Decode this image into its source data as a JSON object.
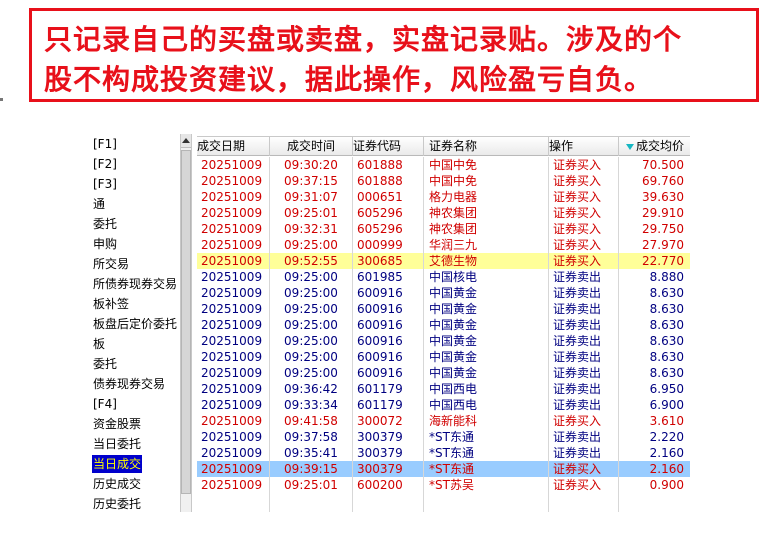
{
  "banner": {
    "line1": "只记录自己的买盘或卖盘，实盘记录贴。涉及的个",
    "line2": "股不构成投资建议，据此操作，风险盈亏自负。"
  },
  "sidebar": {
    "items": [
      "[F1]",
      "[F2]",
      "[F3]",
      "通",
      "委托",
      "申购",
      "所交易",
      "所债券现券交易",
      "板补签",
      "板盘后定价委托",
      "板",
      "委托",
      "债券现券交易",
      "[F4]",
      "资金股票",
      "当日委托",
      "当日成交",
      "历史成交",
      "历史委托"
    ],
    "active_index": 16
  },
  "table": {
    "headers": [
      "成交日期",
      "成交时间",
      "证券代码",
      "证券名称",
      "操作",
      "成交均价"
    ],
    "sort_column": "成交均价",
    "rows": [
      {
        "date": "20251009",
        "time": "09:30:20",
        "code": "601888",
        "name": "中国中免",
        "op": "证券买入",
        "price": "70.500",
        "kind": "buy"
      },
      {
        "date": "20251009",
        "time": "09:37:15",
        "code": "601888",
        "name": "中国中免",
        "op": "证券买入",
        "price": "69.760",
        "kind": "buy"
      },
      {
        "date": "20251009",
        "time": "09:31:07",
        "code": "000651",
        "name": "格力电器",
        "op": "证券买入",
        "price": "39.630",
        "kind": "buy"
      },
      {
        "date": "20251009",
        "time": "09:25:01",
        "code": "605296",
        "name": "神农集团",
        "op": "证券买入",
        "price": "29.910",
        "kind": "buy"
      },
      {
        "date": "20251009",
        "time": "09:32:31",
        "code": "605296",
        "name": "神农集团",
        "op": "证券买入",
        "price": "29.750",
        "kind": "buy"
      },
      {
        "date": "20251009",
        "time": "09:25:00",
        "code": "000999",
        "name": "华润三九",
        "op": "证券买入",
        "price": "27.970",
        "kind": "buy"
      },
      {
        "date": "20251009",
        "time": "09:52:55",
        "code": "300685",
        "name": "艾德生物",
        "op": "证券买入",
        "price": "22.770",
        "kind": "buy",
        "highlight": "yellow"
      },
      {
        "date": "20251009",
        "time": "09:25:00",
        "code": "601985",
        "name": "中国核电",
        "op": "证券卖出",
        "price": "8.880",
        "kind": "sell"
      },
      {
        "date": "20251009",
        "time": "09:25:00",
        "code": "600916",
        "name": "中国黄金",
        "op": "证券卖出",
        "price": "8.630",
        "kind": "sell"
      },
      {
        "date": "20251009",
        "time": "09:25:00",
        "code": "600916",
        "name": "中国黄金",
        "op": "证券卖出",
        "price": "8.630",
        "kind": "sell"
      },
      {
        "date": "20251009",
        "time": "09:25:00",
        "code": "600916",
        "name": "中国黄金",
        "op": "证券卖出",
        "price": "8.630",
        "kind": "sell"
      },
      {
        "date": "20251009",
        "time": "09:25:00",
        "code": "600916",
        "name": "中国黄金",
        "op": "证券卖出",
        "price": "8.630",
        "kind": "sell"
      },
      {
        "date": "20251009",
        "time": "09:25:00",
        "code": "600916",
        "name": "中国黄金",
        "op": "证券卖出",
        "price": "8.630",
        "kind": "sell"
      },
      {
        "date": "20251009",
        "time": "09:25:00",
        "code": "600916",
        "name": "中国黄金",
        "op": "证券卖出",
        "price": "8.630",
        "kind": "sell"
      },
      {
        "date": "20251009",
        "time": "09:36:42",
        "code": "601179",
        "name": "中国西电",
        "op": "证券卖出",
        "price": "6.950",
        "kind": "sell"
      },
      {
        "date": "20251009",
        "time": "09:33:34",
        "code": "601179",
        "name": "中国西电",
        "op": "证券卖出",
        "price": "6.900",
        "kind": "sell"
      },
      {
        "date": "20251009",
        "time": "09:41:58",
        "code": "300072",
        "name": "海新能科",
        "op": "证券买入",
        "price": "3.610",
        "kind": "buy"
      },
      {
        "date": "20251009",
        "time": "09:37:58",
        "code": "300379",
        "name": "*ST东通",
        "op": "证券卖出",
        "price": "2.220",
        "kind": "sell"
      },
      {
        "date": "20251009",
        "time": "09:35:41",
        "code": "300379",
        "name": "*ST东通",
        "op": "证券卖出",
        "price": "2.160",
        "kind": "sell"
      },
      {
        "date": "20251009",
        "time": "09:39:15",
        "code": "300379",
        "name": "*ST东通",
        "op": "证券买入",
        "price": "2.160",
        "kind": "buy",
        "highlight": "blue"
      },
      {
        "date": "20251009",
        "time": "09:25:01",
        "code": "600200",
        "name": "*ST苏吴",
        "op": "证券买入",
        "price": "0.900",
        "kind": "buy"
      }
    ]
  }
}
